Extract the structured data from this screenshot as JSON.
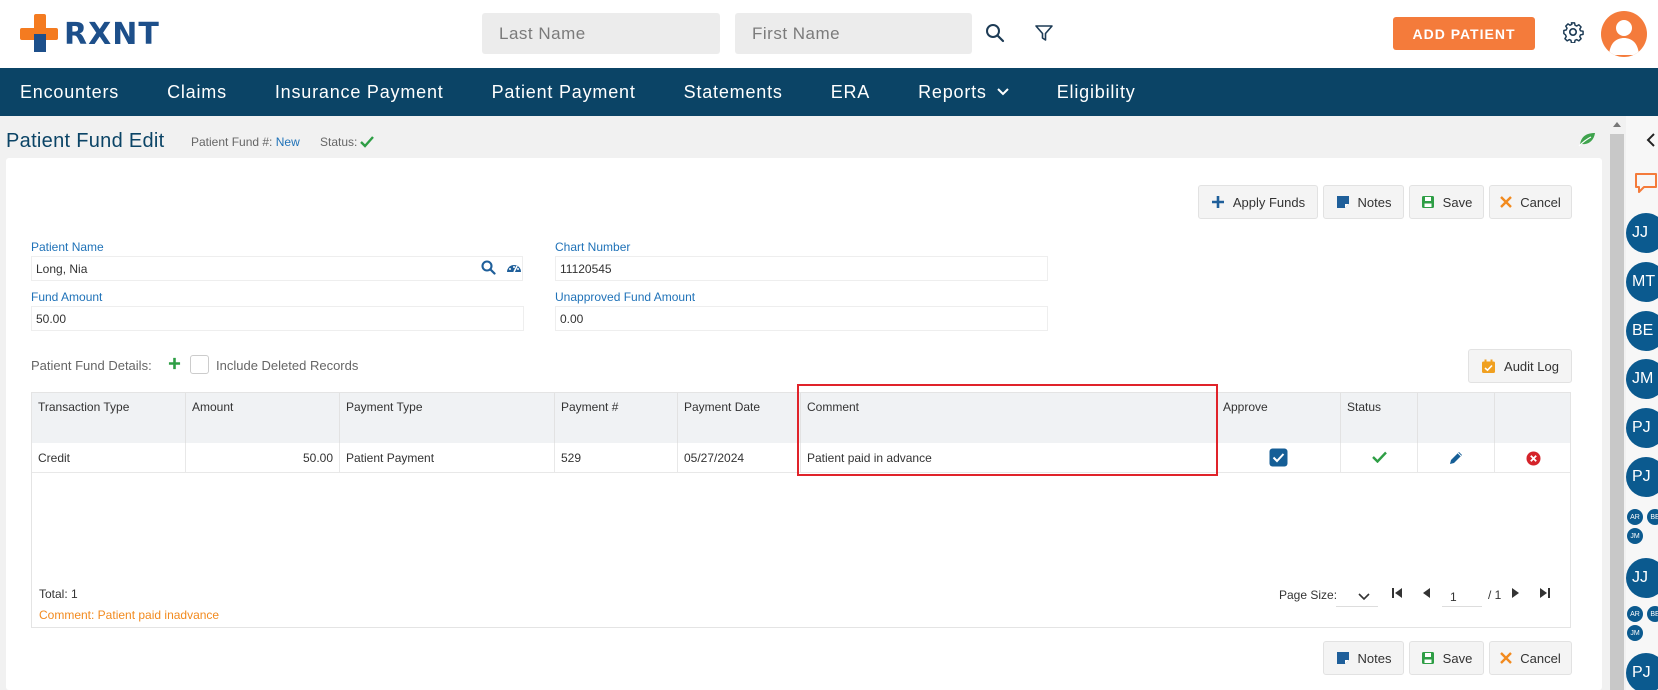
{
  "brand": {
    "name": "RXNT"
  },
  "header": {
    "last_name_placeholder": "Last Name",
    "first_name_placeholder": "First Name",
    "add_patient_label": "ADD PATIENT"
  },
  "nav": {
    "items": [
      "Encounters",
      "Claims",
      "Insurance Payment",
      "Patient Payment",
      "Statements",
      "ERA",
      "Reports",
      "Eligibility"
    ]
  },
  "page": {
    "title": "Patient Fund Edit",
    "fund_no_label": "Patient Fund #:",
    "fund_no_value": "New",
    "status_label": "Status:"
  },
  "actions": {
    "apply_funds": "Apply Funds",
    "notes": "Notes",
    "save": "Save",
    "cancel": "Cancel",
    "audit_log": "Audit Log"
  },
  "form": {
    "patient_name_label": "Patient Name",
    "patient_name_value": "Long, Nia",
    "chart_number_label": "Chart Number",
    "chart_number_value": "11120545",
    "fund_amount_label": "Fund Amount",
    "fund_amount_value": "50.00",
    "unapproved_label": "Unapproved Fund Amount",
    "unapproved_value": "0.00"
  },
  "details": {
    "label": "Patient Fund Details:",
    "include_deleted": "Include Deleted Records"
  },
  "grid": {
    "columns": {
      "transaction_type": "Transaction Type",
      "amount": "Amount",
      "payment_type": "Payment Type",
      "payment_no": "Payment #",
      "payment_date": "Payment Date",
      "comment": "Comment",
      "approve": "Approve",
      "status": "Status"
    },
    "rows": [
      {
        "transaction_type": "Credit",
        "amount": "50.00",
        "payment_type": "Patient Payment",
        "payment_no": "529",
        "payment_date": "05/27/2024",
        "comment": "Patient paid in advance",
        "approved": true
      }
    ],
    "total": "Total: 1",
    "comment_note": "Comment: Patient paid inadvance",
    "page_size_label": "Page Size:",
    "page_value": "1",
    "page_of": "/ 1"
  },
  "rail": {
    "bubbles": [
      "JJ",
      "MT",
      "BE",
      "JM",
      "PJ",
      "PJ",
      "JJ",
      "PJ"
    ],
    "mini_groups": [
      [
        "AR",
        "BE",
        "JM"
      ],
      [
        "AR",
        "BE",
        "JM"
      ]
    ]
  },
  "colors": {
    "brand_orange": "#f47b20",
    "brand_blue": "#1d4f8a",
    "nav_bg": "#0b4466",
    "highlight": "#e0232a",
    "success": "#2e9e45"
  }
}
